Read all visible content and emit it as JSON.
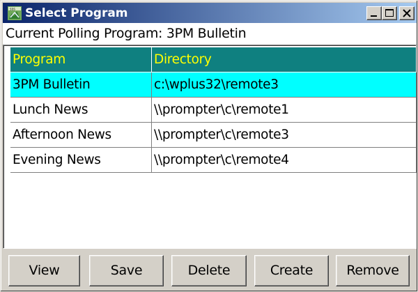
{
  "window": {
    "title": "Select Program",
    "icon": "app-icon",
    "controls": [
      "minimize-icon",
      "maximize-icon",
      "close-icon"
    ],
    "title_bar_color": "#0a246a"
  },
  "polling": {
    "label": "Current Polling Program: 3PM Bulletin"
  },
  "table": {
    "headers": [
      "Program",
      "Directory"
    ],
    "header_bg": "#0f8080",
    "header_fg": "#ffff00",
    "selected_bg": "#00ffff",
    "rows": [
      {
        "program": "3PM Bulletin",
        "directory": "c:\\wplus32\\remote3",
        "selected": true
      },
      {
        "program": "Lunch News",
        "directory": "\\\\prompter\\c\\remote1",
        "selected": false
      },
      {
        "program": "Afternoon News",
        "directory": "\\\\prompter\\c\\remote3",
        "selected": false
      },
      {
        "program": "Evening News",
        "directory": "\\\\prompter\\c\\remote4",
        "selected": false
      }
    ]
  },
  "buttons": {
    "view": "View",
    "save": "Save",
    "delete": "Delete",
    "create": "Create",
    "remove": "Remove"
  }
}
